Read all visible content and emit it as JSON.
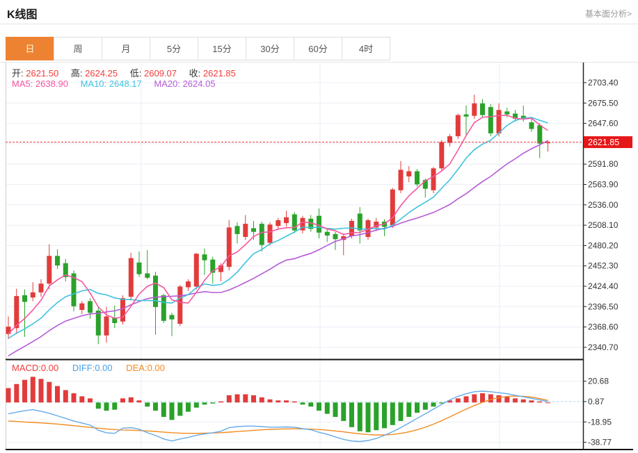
{
  "header": {
    "title": "K线图",
    "link": "基本面分析>"
  },
  "tabs": [
    {
      "label": "日",
      "active": true
    },
    {
      "label": "周",
      "active": false
    },
    {
      "label": "月",
      "active": false
    },
    {
      "label": "5分",
      "active": false
    },
    {
      "label": "15分",
      "active": false
    },
    {
      "label": "30分",
      "active": false
    },
    {
      "label": "60分",
      "active": false
    },
    {
      "label": "4时",
      "active": false
    }
  ],
  "legend": {
    "ohlc": [
      {
        "label": "开:",
        "value": "2621.50"
      },
      {
        "label": "高:",
        "value": "2624.25"
      },
      {
        "label": "低:",
        "value": "2609.07"
      },
      {
        "label": "收:",
        "value": "2621.85"
      }
    ],
    "ma5": "MA5: 2638.90",
    "ma10": "MA10: 2648.17",
    "ma20": "MA20: 2624.05"
  },
  "macd_legend": {
    "macd": "MACD:0.00",
    "diff": "DIFF:0.00",
    "dea": "DEA:0.00"
  },
  "price_axis": {
    "current": "2621.85",
    "ticks": [
      {
        "v": 2703.4,
        "label": "2703.40"
      },
      {
        "v": 2675.5,
        "label": "2675.50"
      },
      {
        "v": 2647.6,
        "label": "2647.60"
      },
      {
        "v": 2619.7,
        "label": "",
        "hidden": true
      },
      {
        "v": 2591.8,
        "label": "2591.80"
      },
      {
        "v": 2563.9,
        "label": "2563.90"
      },
      {
        "v": 2536.0,
        "label": "2536.00"
      },
      {
        "v": 2508.1,
        "label": "2508.10"
      },
      {
        "v": 2480.2,
        "label": "2480.20"
      },
      {
        "v": 2452.3,
        "label": "2452.30"
      },
      {
        "v": 2424.4,
        "label": "2424.40"
      },
      {
        "v": 2396.5,
        "label": "2396.50"
      },
      {
        "v": 2368.6,
        "label": "2368.60"
      },
      {
        "v": 2340.7,
        "label": "2340.70"
      }
    ]
  },
  "macd_axis": {
    "ticks": [
      {
        "v": 20.68,
        "label": "20.68",
        "dashed": false
      },
      {
        "v": 0.87,
        "label": "0.87",
        "dashed": true
      },
      {
        "v": -18.95,
        "label": "-18.95",
        "dashed": false
      },
      {
        "v": -38.77,
        "label": "-38.77",
        "dashed": false
      }
    ]
  },
  "colors": {
    "up": "#e23b3b",
    "down": "#2aa22a",
    "ma5": "#f7569f",
    "ma10": "#3fc2de",
    "ma20": "#b55ad6",
    "diff_line": "#66aae8",
    "dea_line": "#f28b1f",
    "grid": "#e9eef5",
    "axis": "#222222",
    "border_light": "#cccccc",
    "price_line": "#f23030",
    "badge_bg": "#e61717",
    "badge_text": "#ffffff",
    "zero_dashed": "#a5d4f0",
    "tab_active_bg": "#ed8233"
  },
  "chart_data": {
    "type": "candlestick+macd",
    "title": "K线图 daily gold candlestick with MA5/MA10/MA20 and MACD",
    "current_price": 2621.85,
    "price_axis_range": [
      2340.7,
      2703.4
    ],
    "macd_axis_range": [
      -38.77,
      20.68
    ],
    "grid": true,
    "candles_ohlc": [
      [
        2359,
        2383,
        2352,
        2369
      ],
      [
        2367,
        2421,
        2359,
        2411
      ],
      [
        2412,
        2420,
        2355,
        2403
      ],
      [
        2409,
        2430,
        2404,
        2416
      ],
      [
        2416,
        2434,
        2410,
        2428
      ],
      [
        2428,
        2482,
        2420,
        2466
      ],
      [
        2466,
        2475,
        2448,
        2453
      ],
      [
        2456,
        2462,
        2431,
        2437
      ],
      [
        2442,
        2446,
        2390,
        2397
      ],
      [
        2392,
        2404,
        2386,
        2401
      ],
      [
        2404,
        2408,
        2380,
        2388
      ],
      [
        2391,
        2396,
        2345,
        2357
      ],
      [
        2357,
        2396,
        2347,
        2383
      ],
      [
        2381,
        2398,
        2367,
        2374
      ],
      [
        2376,
        2412,
        2372,
        2408
      ],
      [
        2410,
        2470,
        2405,
        2463
      ],
      [
        2457,
        2472,
        2437,
        2441
      ],
      [
        2442,
        2474,
        2434,
        2436
      ],
      [
        2439,
        2444,
        2358,
        2396
      ],
      [
        2412,
        2414,
        2374,
        2377
      ],
      [
        2385,
        2388,
        2356,
        2379
      ],
      [
        2373,
        2426,
        2370,
        2424
      ],
      [
        2423,
        2434,
        2418,
        2431
      ],
      [
        2424,
        2470,
        2420,
        2469
      ],
      [
        2468,
        2476,
        2440,
        2460
      ],
      [
        2461,
        2465,
        2428,
        2443
      ],
      [
        2444,
        2456,
        2431,
        2453
      ],
      [
        2451,
        2515,
        2446,
        2505
      ],
      [
        2507,
        2512,
        2483,
        2496
      ],
      [
        2492,
        2522,
        2488,
        2510
      ],
      [
        2504,
        2514,
        2488,
        2499
      ],
      [
        2510,
        2513,
        2472,
        2481
      ],
      [
        2484,
        2512,
        2480,
        2509
      ],
      [
        2507,
        2518,
        2502,
        2515
      ],
      [
        2511,
        2528,
        2506,
        2519
      ],
      [
        2523,
        2526,
        2497,
        2501
      ],
      [
        2501,
        2521,
        2497,
        2518
      ],
      [
        2517,
        2522,
        2499,
        2503
      ],
      [
        2521,
        2531,
        2490,
        2498
      ],
      [
        2499,
        2503,
        2485,
        2494
      ],
      [
        2496,
        2499,
        2474,
        2489
      ],
      [
        2488,
        2495,
        2467,
        2493
      ],
      [
        2493,
        2517,
        2490,
        2514
      ],
      [
        2524,
        2533,
        2483,
        2501
      ],
      [
        2492,
        2517,
        2488,
        2515
      ],
      [
        2505,
        2518,
        2500,
        2513
      ],
      [
        2513,
        2516,
        2493,
        2506
      ],
      [
        2508,
        2559,
        2504,
        2557
      ],
      [
        2556,
        2596,
        2552,
        2584
      ],
      [
        2575,
        2589,
        2567,
        2582
      ],
      [
        2582,
        2585,
        2561,
        2564
      ],
      [
        2570,
        2572,
        2546,
        2558
      ],
      [
        2556,
        2588,
        2552,
        2586
      ],
      [
        2586,
        2625,
        2582,
        2622
      ],
      [
        2621,
        2633,
        2616,
        2630
      ],
      [
        2630,
        2661,
        2626,
        2659
      ],
      [
        2660,
        2672,
        2632,
        2657
      ],
      [
        2658,
        2687,
        2654,
        2675
      ],
      [
        2675,
        2681,
        2656,
        2659
      ],
      [
        2670,
        2674,
        2630,
        2634
      ],
      [
        2634,
        2675,
        2630,
        2666
      ],
      [
        2664,
        2669,
        2656,
        2660
      ],
      [
        2661,
        2666,
        2650,
        2654
      ],
      [
        2658,
        2672,
        2650,
        2653
      ],
      [
        2649,
        2654,
        2636,
        2640
      ],
      [
        2645,
        2648,
        2600,
        2620
      ],
      [
        2621.5,
        2624.25,
        2609.07,
        2621.85
      ]
    ],
    "ma_seed_history": [
      2270,
      2278,
      2286,
      2294,
      2302,
      2310,
      2317,
      2324,
      2330,
      2336,
      2340,
      2344,
      2347,
      2350,
      2352,
      2354,
      2356,
      2358,
      2360
    ],
    "ma_windows": {
      "ma5": 5,
      "ma10": 10,
      "ma20": 20
    },
    "macd": {
      "hist": [
        14,
        18,
        22,
        25,
        23,
        20,
        16,
        12,
        9,
        6,
        4,
        -6,
        -8,
        -7,
        4,
        5,
        2,
        -4,
        -8,
        -14,
        -17,
        -13,
        -9,
        -5,
        -2,
        -1,
        1,
        7,
        8,
        8,
        7,
        5,
        3,
        2,
        2,
        1,
        -2,
        -4,
        -8,
        -11,
        -14,
        -18,
        -24,
        -28,
        -29,
        -27,
        -25,
        -22,
        -18,
        -14,
        -10,
        -7,
        -4,
        -1,
        2,
        4,
        6,
        8,
        9,
        8,
        7,
        6,
        4,
        3,
        2,
        1,
        0
      ],
      "diff": [
        -11,
        -9.5,
        -8,
        -7,
        -8.5,
        -10.5,
        -13,
        -15.5,
        -18,
        -20,
        -22,
        -27,
        -29.5,
        -30,
        -25,
        -24.5,
        -26,
        -29.5,
        -32,
        -35.5,
        -37.5,
        -35.5,
        -34,
        -32,
        -30.5,
        -29.5,
        -28,
        -24.5,
        -23.5,
        -23,
        -23,
        -23.5,
        -24,
        -24,
        -23.8,
        -24,
        -25.5,
        -26.5,
        -29,
        -31,
        -33.5,
        -36,
        -37.5,
        -38,
        -37,
        -35,
        -32,
        -28.5,
        -24.5,
        -20,
        -15.5,
        -11,
        -6.5,
        -2,
        2.5,
        6,
        8.5,
        10.5,
        11,
        10.5,
        9.5,
        8.5,
        7,
        5.5,
        4,
        2.5,
        0.8
      ],
      "dea": [
        -18,
        -18.5,
        -19,
        -19.4,
        -19.9,
        -20.4,
        -21,
        -21.8,
        -22.6,
        -23.4,
        -24.2,
        -25,
        -25.8,
        -26.4,
        -26.8,
        -27,
        -27.3,
        -27.7,
        -28.2,
        -28.8,
        -29.4,
        -29.8,
        -30,
        -30,
        -29.9,
        -29.7,
        -29.4,
        -28.9,
        -28.3,
        -27.7,
        -27.1,
        -26.6,
        -26.2,
        -25.9,
        -25.7,
        -25.6,
        -25.7,
        -25.9,
        -26.3,
        -26.9,
        -27.7,
        -28.6,
        -29.6,
        -30.5,
        -31.2,
        -31.6,
        -31.6,
        -31.1,
        -30.1,
        -28.6,
        -26.6,
        -24.1,
        -21.1,
        -17.7,
        -14,
        -10.2,
        -6.5,
        -3,
        0.2,
        2.8,
        4.7,
        5.8,
        6.2,
        6,
        5.2,
        3.8,
        2
      ]
    }
  }
}
